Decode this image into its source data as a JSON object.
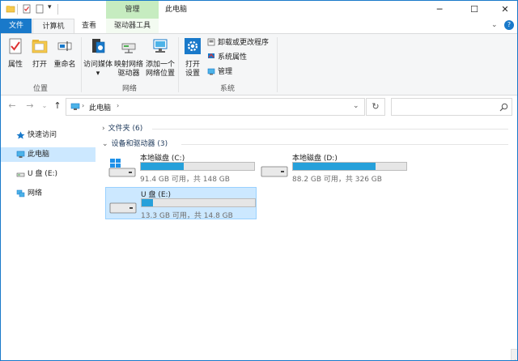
{
  "window": {
    "title": "此电脑",
    "contextual_tab": "管理"
  },
  "tabs": {
    "file": "文件",
    "computer": "计算机",
    "view": "查看",
    "drive_tools": "驱动器工具"
  },
  "ribbon": {
    "location": {
      "label": "位置",
      "properties": "属性",
      "open": "打开",
      "rename": "重命名"
    },
    "network": {
      "label": "网络",
      "access_media": "访问媒体",
      "map_drive_1": "映射网络",
      "map_drive_2": "驱动器",
      "add_location_1": "添加一个",
      "add_location_2": "网络位置"
    },
    "system": {
      "label": "系统",
      "open_settings_1": "打开",
      "open_settings_2": "设置",
      "uninstall": "卸载或更改程序",
      "sys_props": "系统属性",
      "manage": "管理"
    }
  },
  "address": {
    "path": "此电脑"
  },
  "sidebar": {
    "items": [
      "快速访问",
      "此电脑",
      "U 盘 (E:)",
      "网络"
    ]
  },
  "content": {
    "folders_header": "文件夹 (6)",
    "devices_header": "设备和驱动器 (3)",
    "drives": [
      {
        "name": "本地磁盘 (C:)",
        "info": "91.4 GB 可用，共 148 GB",
        "used_fraction": 0.38
      },
      {
        "name": "本地磁盘 (D:)",
        "info": "88.2 GB 可用，共 326 GB",
        "used_fraction": 0.73
      },
      {
        "name": "U 盘 (E:)",
        "info": "13.3 GB 可用，共 14.8 GB",
        "used_fraction": 0.1
      }
    ]
  },
  "colors": {
    "accent": "#1979ca",
    "selection": "#cce8ff",
    "contextual": "#c6ecc0",
    "drive_bar": "#26a0da"
  }
}
